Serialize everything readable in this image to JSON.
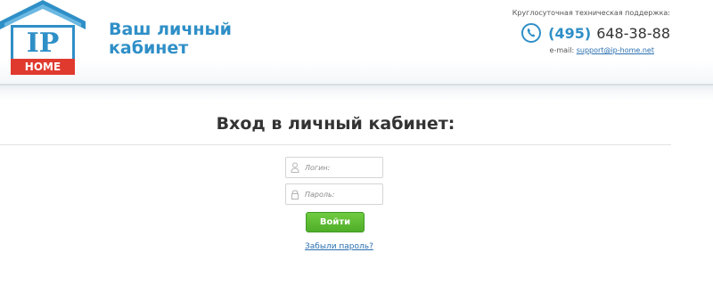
{
  "header": {
    "logo": {
      "top_text": "IP",
      "bottom_text": "HOME"
    },
    "brand_title": "Ваш личный кабинет",
    "support": {
      "label": "Круглосуточная техническая поддержка:",
      "phone_code": "(495)",
      "phone_number": "648-38-88",
      "email_prefix": "e-mail:",
      "email": "support@ip-home.net"
    }
  },
  "login": {
    "title": "Вход в личный кабинет:",
    "login_placeholder": "Логин:",
    "password_placeholder": "Пароль:",
    "submit_label": "Войти",
    "forgot_label": "Забыли пароль?"
  },
  "colors": {
    "accent_blue": "#2f8fc7",
    "logo_red": "#e03a2f",
    "button_green": "#4fae28"
  },
  "icons": {
    "phone": "phone-icon",
    "user": "user-icon",
    "lock": "lock-icon"
  }
}
